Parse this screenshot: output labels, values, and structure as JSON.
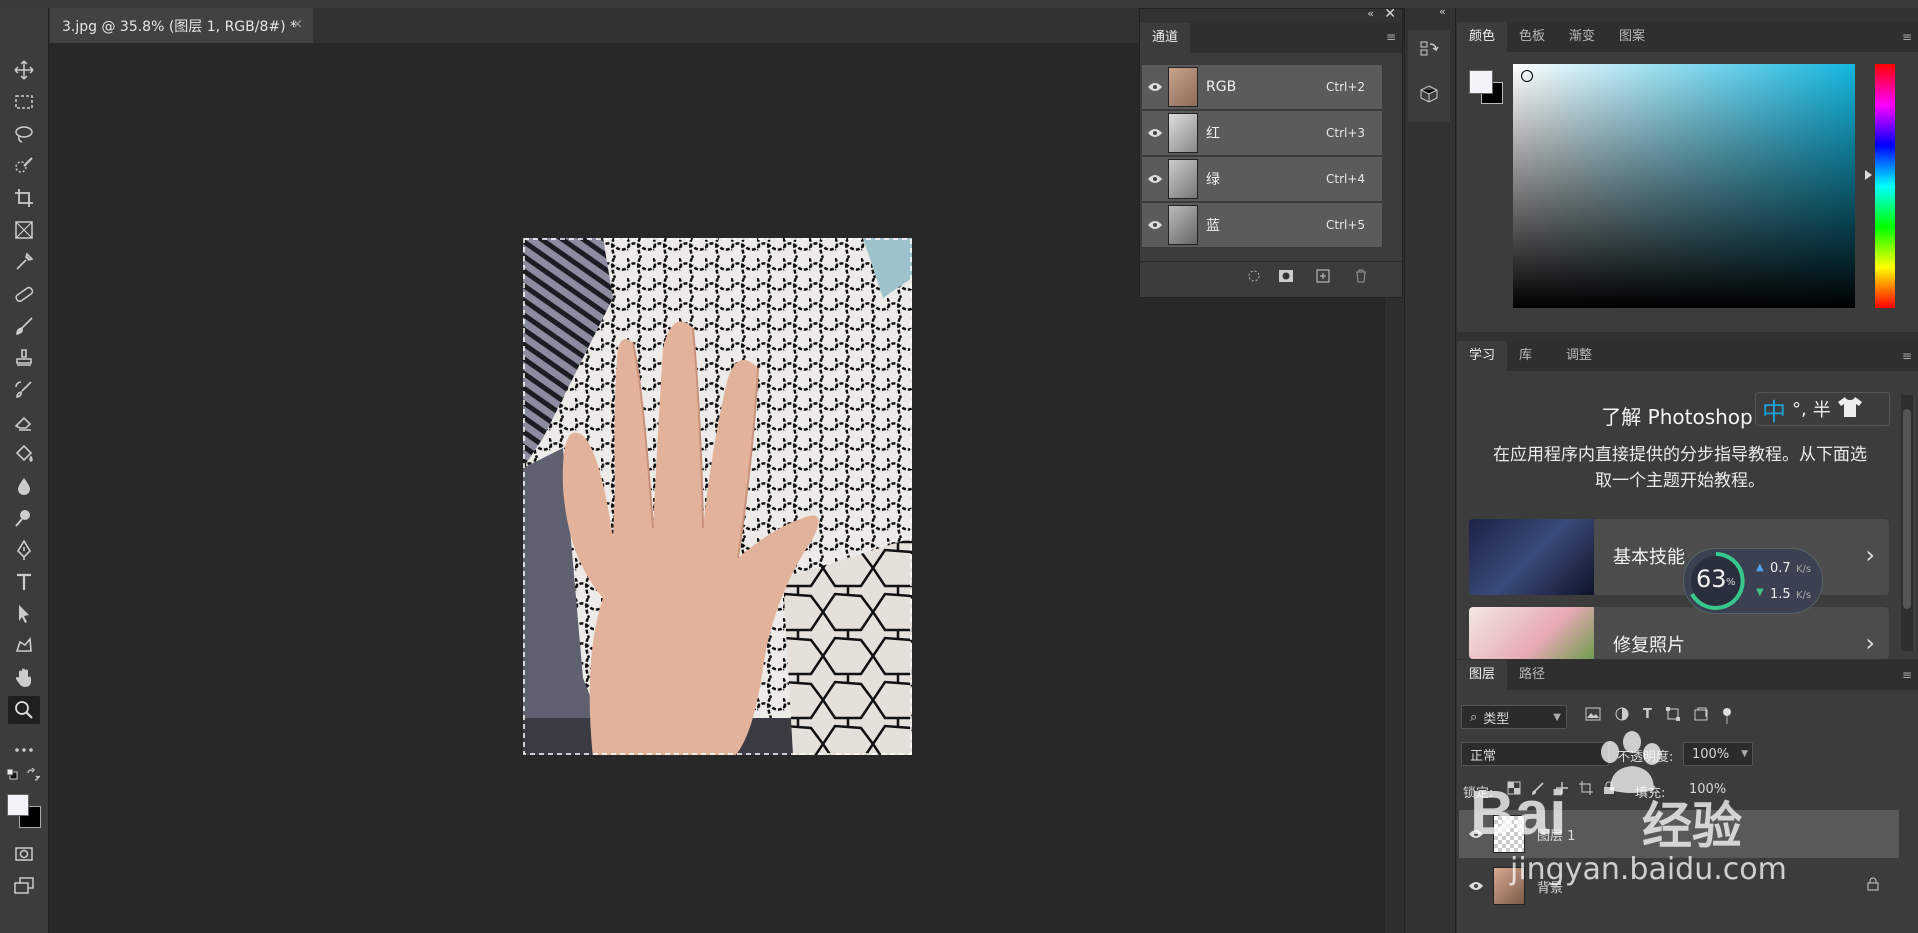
{
  "document_tab": {
    "title": "3.jpg @ 35.8% (图层 1, RGB/8#) *",
    "close": "×"
  },
  "channels_panel": {
    "tab": "通道",
    "channels": [
      {
        "name": "RGB",
        "shortcut": "Ctrl+2"
      },
      {
        "name": "红",
        "shortcut": "Ctrl+3"
      },
      {
        "name": "绿",
        "shortcut": "Ctrl+4"
      },
      {
        "name": "蓝",
        "shortcut": "Ctrl+5"
      }
    ]
  },
  "color_panel": {
    "tabs": [
      "颜色",
      "色板",
      "渐变",
      "图案"
    ]
  },
  "learn_panel": {
    "tabs": [
      "学习",
      "库",
      "调整"
    ],
    "heading": "了解 Photoshop",
    "description": "在应用程序内直接提供的分步指导教程。从下面选取一个主题开始教程。",
    "cards": [
      {
        "title": "基本技能"
      },
      {
        "title": "修复照片"
      }
    ]
  },
  "ime_bar": {
    "mode": "中",
    "punct": "°,",
    "width": "半"
  },
  "net_widget": {
    "percent": "63",
    "pct_sign": "%",
    "up": "0.7",
    "down": "1.5",
    "unit": "K/s"
  },
  "layers_panel": {
    "tabs": [
      "图层",
      "路径"
    ],
    "filter_kind": "类型",
    "blend_mode": "正常",
    "opacity_label": "不透明度:",
    "opacity_value": "100%",
    "lock_label": "锁定:",
    "fill_label": "填充:",
    "fill_value": "100%",
    "layers": [
      {
        "name": "图层 1"
      },
      {
        "name": "背景"
      }
    ]
  },
  "watermark": {
    "brand": "Bai",
    "brand2": "经验",
    "url": "jingyan.baidu.com"
  },
  "colors": {
    "accent": "#1ea0d8",
    "panel": "#3c3c3c",
    "canvas": "#282828"
  }
}
